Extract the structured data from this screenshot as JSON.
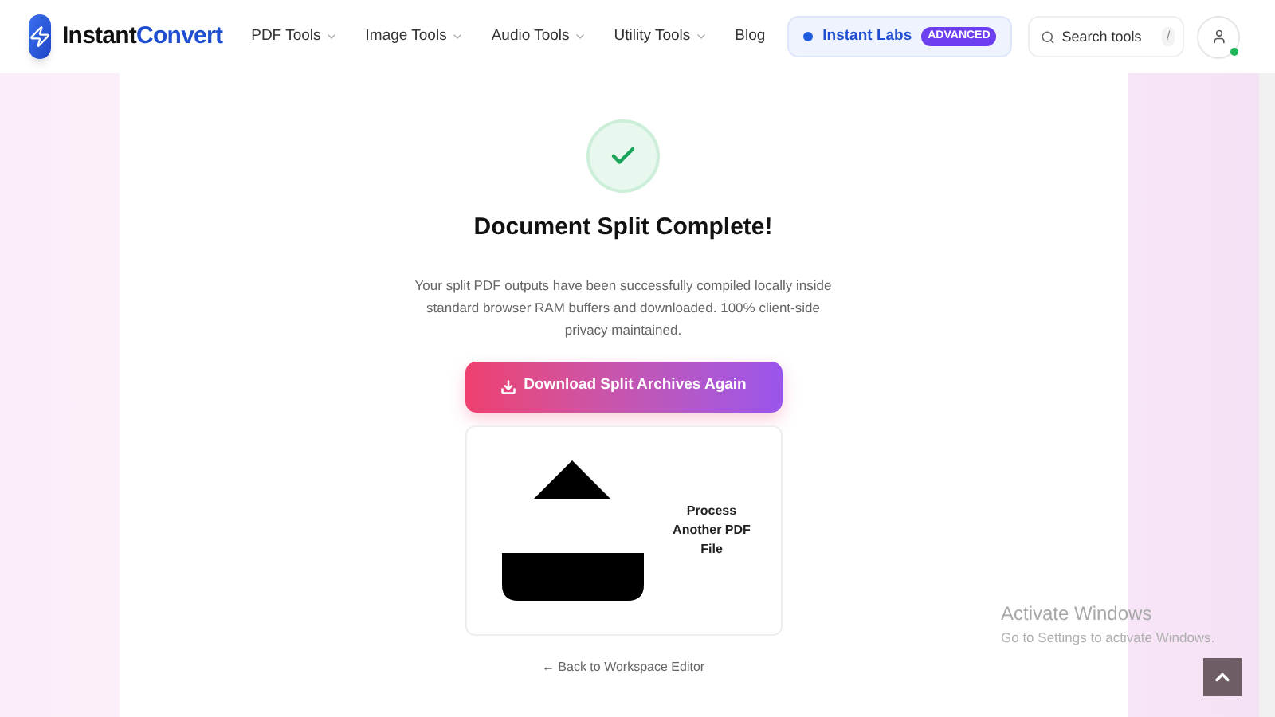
{
  "header": {
    "logo": {
      "part1": "Instant",
      "part2": "Convert"
    },
    "nav": [
      {
        "label": "PDF Tools",
        "dropdown": true
      },
      {
        "label": "Image Tools",
        "dropdown": true
      },
      {
        "label": "Audio Tools",
        "dropdown": true
      },
      {
        "label": "Utility Tools",
        "dropdown": true
      },
      {
        "label": "Blog",
        "dropdown": false
      }
    ],
    "labs": {
      "label": "Instant Labs",
      "badge": "ADVANCED"
    },
    "search": {
      "placeholder": "Search tools",
      "shortcut": "/"
    },
    "account": {
      "online": true
    }
  },
  "result": {
    "title": "Document Split Complete!",
    "message": "Your split PDF outputs have been successfully compiled locally inside standard browser RAM buffers and downloaded. 100% client-side privacy maintained.",
    "download_button": "Download Split Archives Again",
    "process_card": "Process Another PDF File",
    "back_link": "← Back to Workspace Editor"
  },
  "os_overlay": {
    "title": "Activate Windows",
    "subtitle": "Go to Settings to activate Windows."
  }
}
